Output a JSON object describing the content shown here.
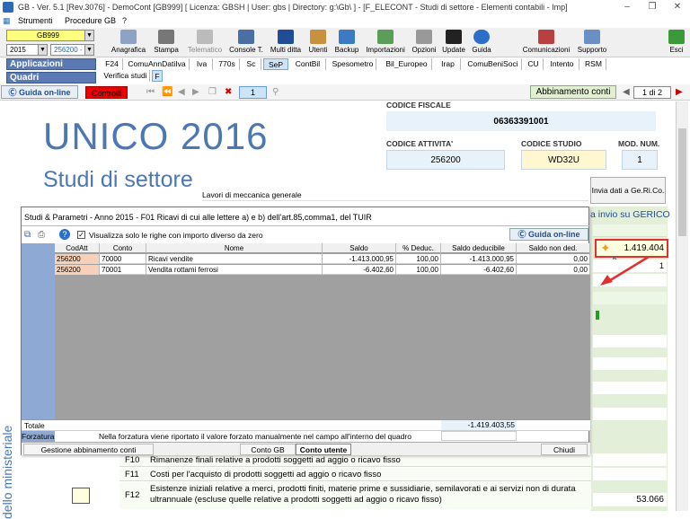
{
  "title_bar": {
    "text": "GB - Ver. 5.1 [Rev.3076] - DemoCont [GB999]     [ Licenza: GBSH | User: gbs | Directory: g:\\Gb\\ ] - [F_ELECONT - Studi di settore - Elementi contabili - Imp]"
  },
  "menu": {
    "items": [
      "Strumenti",
      "Procedure GB",
      "?"
    ]
  },
  "toolbar": {
    "company_code": "GB999",
    "year": "2015",
    "code": "256200 -",
    "buttons": [
      "Anagrafica",
      "Stampa",
      "Telematico",
      "Console T.",
      "Multi ditta",
      "Utenti",
      "Backup",
      "Importazioni",
      "Opzioni",
      "Update",
      "Guida",
      "Comunicazioni",
      "Supporto",
      "Esci"
    ]
  },
  "nav": {
    "applicazioni": "Applicazioni",
    "quadri": "Quadri"
  },
  "tabs": [
    "F24",
    "ComuAnnDatiIva",
    "Iva",
    "770s",
    "Sc",
    "SeP",
    "ContBil",
    "Spesometro",
    "Bil_Europeo",
    "Irap",
    "ComuBeniSoci",
    "CU",
    "Intento",
    "RSM"
  ],
  "subtabs": [
    "Verifica studi",
    "F"
  ],
  "row2": {
    "guida": "Guida on-line",
    "controlli": "Controlli",
    "page_box": "1",
    "abbinamento": "Abbinamento conti",
    "page_of": "1 di 2"
  },
  "header": {
    "title_big": "UNICO 2016",
    "subtitle": "Studi di settore",
    "codice_fiscale_label": "CODICE FISCALE",
    "codice_fiscale": "06363391001",
    "codice_attivita_label": "CODICE ATTIVITA'",
    "codice_attivita": "256200",
    "codice_studio_label": "CODICE STUDIO",
    "codice_studio": "WD32U",
    "mod_num_label": "MOD. NUM.",
    "mod_num": "1",
    "attivita_desc": "Lavori di meccanica generale",
    "invia_btn": "Invia dati a Ge.Ri.Co.",
    "side_header": "a invio su GERICO"
  },
  "dialog": {
    "title": "Studi & Parametri - Anno 2015 - F01  Ricavi di cui alle lettere a) e b) dell'art.85,comma1, del TUIR",
    "checkbox_label": "Visualizza solo le righe con importo diverso da zero",
    "guida": "Guida on-line",
    "columns": [
      "CodAtt",
      "Conto",
      "Nome",
      "Saldo",
      "% Deduc.",
      "Saldo deducibile",
      "Saldo non ded."
    ],
    "rows": [
      [
        "256200",
        "70000",
        "Ricavi vendite",
        "-1.413.000,95",
        "100,00",
        "-1.413.000,95",
        "0,00"
      ],
      [
        "256200",
        "70001",
        "Vendita rottami ferrosi",
        "-6.402,60",
        "100,00",
        "-6.402,60",
        "0,00"
      ]
    ],
    "totale_label": "Totale",
    "totale": "-1.419.403,55",
    "forzatura_label": "Forzatura",
    "forzatura_note": "Nella forzatura viene riportato il valore forzato manualmente nel campo all'interno del quadro",
    "gestione_btn": "Gestione abbinamento conti",
    "conto_gb_btn": "Conto GB",
    "conto_utente_btn": "Conto utente",
    "chiudi_btn": "Chiudi"
  },
  "side": {
    "callout_value": "1.419.404",
    "row2_value": "1",
    "f12_value": "53.066"
  },
  "lower_rows": [
    {
      "code": "F10",
      "text": "Rimanenze finali relative a prodotti soggetti ad aggio o ricavo fisso"
    },
    {
      "code": "F11",
      "text": "Costi per l'acquisto di prodotti soggetti ad aggio o ricavo fisso"
    },
    {
      "code": "F12",
      "text": "Esistenze iniziali relative a merci, prodotti finiti, materie prime e sussidiarie, semilavorati e ai servizi non di durata ultrannuale (escluse quelle relative a prodotti soggetti ad aggio o ricavo fisso)"
    }
  ],
  "vertical_text": "dello ministeriale"
}
